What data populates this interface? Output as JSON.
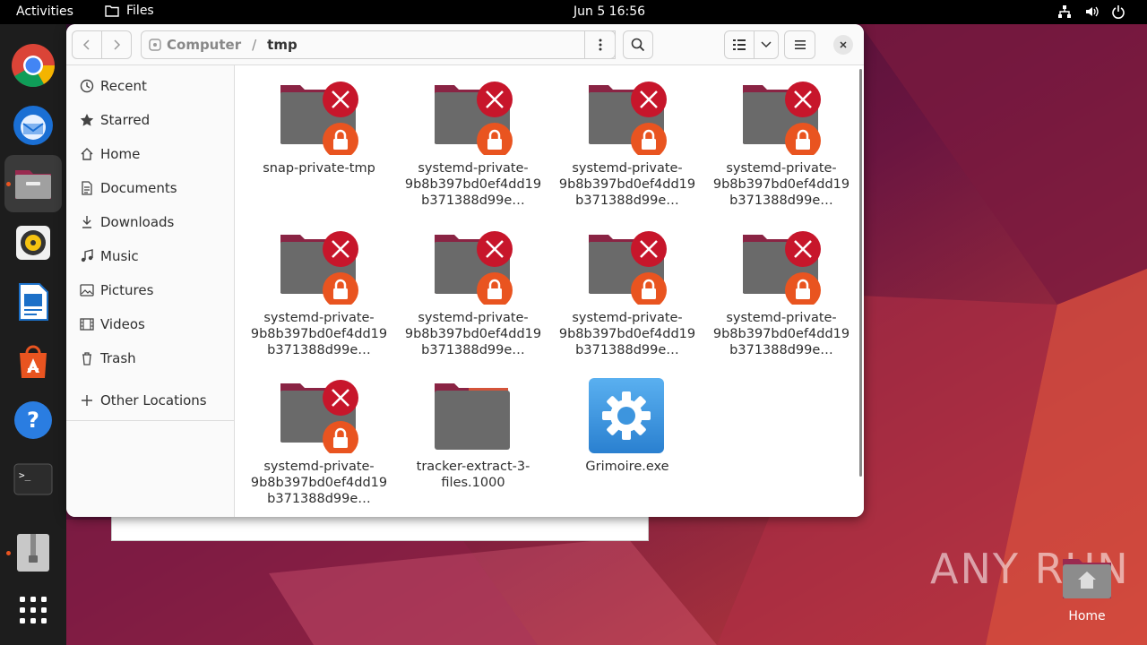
{
  "topbar": {
    "activities": "Activities",
    "app_name": "Files",
    "clock": "Jun 5  16:56"
  },
  "window": {
    "path": {
      "root": "Computer",
      "separator": "/",
      "current": "tmp"
    }
  },
  "sidebar": {
    "items": [
      {
        "label": "Recent",
        "icon": "clock-icon"
      },
      {
        "label": "Starred",
        "icon": "star-icon"
      },
      {
        "label": "Home",
        "icon": "home-icon"
      },
      {
        "label": "Documents",
        "icon": "document-icon"
      },
      {
        "label": "Downloads",
        "icon": "download-icon"
      },
      {
        "label": "Music",
        "icon": "music-icon"
      },
      {
        "label": "Pictures",
        "icon": "picture-icon"
      },
      {
        "label": "Videos",
        "icon": "video-icon"
      },
      {
        "label": "Trash",
        "icon": "trash-icon"
      }
    ],
    "other_locations": "Other Locations"
  },
  "files": [
    {
      "name": "snap-private-tmp",
      "type": "locked-folder"
    },
    {
      "name": "systemd-private-9b8b397bd0ef4dd19b371388d99e…",
      "type": "locked-folder"
    },
    {
      "name": "systemd-private-9b8b397bd0ef4dd19b371388d99e…",
      "type": "locked-folder"
    },
    {
      "name": "systemd-private-9b8b397bd0ef4dd19b371388d99e…",
      "type": "locked-folder"
    },
    {
      "name": "systemd-private-9b8b397bd0ef4dd19b371388d99e…",
      "type": "locked-folder"
    },
    {
      "name": "systemd-private-9b8b397bd0ef4dd19b371388d99e…",
      "type": "locked-folder"
    },
    {
      "name": "systemd-private-9b8b397bd0ef4dd19b371388d99e…",
      "type": "locked-folder"
    },
    {
      "name": "systemd-private-9b8b397bd0ef4dd19b371388d99e…",
      "type": "locked-folder"
    },
    {
      "name": "systemd-private-9b8b397bd0ef4dd19b371388d99e…",
      "type": "locked-folder"
    },
    {
      "name": "tracker-extract-3-files.1000",
      "type": "folder"
    },
    {
      "name": "Grimoire.exe",
      "type": "executable"
    }
  ],
  "desktop": {
    "home_label": "Home",
    "watermark": "ANY RUN"
  },
  "colors": {
    "accent": "#e95420",
    "error_red": "#c7162b",
    "folder_gray": "#6a6a6a",
    "folder_tab": "#8a2444"
  }
}
